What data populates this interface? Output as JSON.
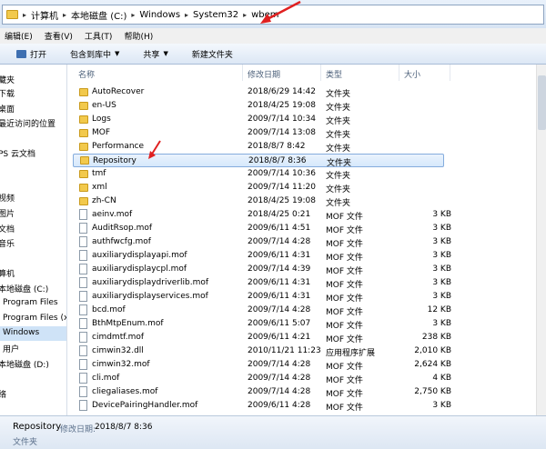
{
  "address_bar": {
    "crumbs": [
      "计算机",
      "本地磁盘 (C:)",
      "Windows",
      "System32",
      "wbem"
    ]
  },
  "menu": {
    "items": [
      "编辑(E)",
      "查看(V)",
      "工具(T)",
      "帮助(H)"
    ]
  },
  "toolbar": {
    "open_label": "打开",
    "include_label": "包含到库中",
    "share_label": "共享",
    "new_folder_label": "新建文件夹"
  },
  "nav": {
    "items": [
      "藏夹",
      "下载",
      "桌面",
      "最近访问的位置",
      "PS 云文档",
      "视频",
      "图片",
      "文档",
      "音乐",
      "算机",
      "本地磁盘 (C:)",
      "Program Files",
      "Program Files (x",
      "Windows",
      "用户",
      "本地磁盘 (D:)",
      "络"
    ]
  },
  "columns": {
    "name": "名称",
    "modified": "修改日期",
    "type": "类型",
    "size": "大小"
  },
  "files": [
    {
      "name": "AutoRecover",
      "date": "2018/6/29 14:42",
      "type": "文件夹",
      "size": "",
      "kind": "folder"
    },
    {
      "name": "en-US",
      "date": "2018/4/25 19:08",
      "type": "文件夹",
      "size": "",
      "kind": "folder"
    },
    {
      "name": "Logs",
      "date": "2009/7/14 10:34",
      "type": "文件夹",
      "size": "",
      "kind": "folder"
    },
    {
      "name": "MOF",
      "date": "2009/7/14 13:08",
      "type": "文件夹",
      "size": "",
      "kind": "folder"
    },
    {
      "name": "Performance",
      "date": "2018/8/7 8:42",
      "type": "文件夹",
      "size": "",
      "kind": "folder"
    },
    {
      "name": "Repository",
      "date": "2018/8/7 8:36",
      "type": "文件夹",
      "size": "",
      "kind": "folder",
      "selected": true
    },
    {
      "name": "tmf",
      "date": "2009/7/14 10:36",
      "type": "文件夹",
      "size": "",
      "kind": "folder"
    },
    {
      "name": "xml",
      "date": "2009/7/14 11:20",
      "type": "文件夹",
      "size": "",
      "kind": "folder"
    },
    {
      "name": "zh-CN",
      "date": "2018/4/25 19:08",
      "type": "文件夹",
      "size": "",
      "kind": "folder"
    },
    {
      "name": "aeinv.mof",
      "date": "2018/4/25 0:21",
      "type": "MOF 文件",
      "size": "3 KB",
      "kind": "file"
    },
    {
      "name": "AuditRsop.mof",
      "date": "2009/6/11 4:51",
      "type": "MOF 文件",
      "size": "3 KB",
      "kind": "file"
    },
    {
      "name": "authfwcfg.mof",
      "date": "2009/7/14 4:28",
      "type": "MOF 文件",
      "size": "3 KB",
      "kind": "file"
    },
    {
      "name": "auxiliarydisplayapi.mof",
      "date": "2009/6/11 4:31",
      "type": "MOF 文件",
      "size": "3 KB",
      "kind": "file"
    },
    {
      "name": "auxiliarydisplaycpl.mof",
      "date": "2009/7/14 4:39",
      "type": "MOF 文件",
      "size": "3 KB",
      "kind": "file"
    },
    {
      "name": "auxiliarydisplaydriverlib.mof",
      "date": "2009/6/11 4:31",
      "type": "MOF 文件",
      "size": "3 KB",
      "kind": "file"
    },
    {
      "name": "auxiliarydisplayservices.mof",
      "date": "2009/6/11 4:31",
      "type": "MOF 文件",
      "size": "3 KB",
      "kind": "file"
    },
    {
      "name": "bcd.mof",
      "date": "2009/7/14 4:28",
      "type": "MOF 文件",
      "size": "12 KB",
      "kind": "file"
    },
    {
      "name": "BthMtpEnum.mof",
      "date": "2009/6/11 5:07",
      "type": "MOF 文件",
      "size": "3 KB",
      "kind": "file"
    },
    {
      "name": "cimdmtf.mof",
      "date": "2009/6/11 4:21",
      "type": "MOF 文件",
      "size": "238 KB",
      "kind": "file"
    },
    {
      "name": "cimwin32.dll",
      "date": "2010/11/21 11:23",
      "type": "应用程序扩展",
      "size": "2,010 KB",
      "kind": "file"
    },
    {
      "name": "cimwin32.mof",
      "date": "2009/7/14 4:28",
      "type": "MOF 文件",
      "size": "2,624 KB",
      "kind": "file"
    },
    {
      "name": "cli.mof",
      "date": "2009/7/14 4:28",
      "type": "MOF 文件",
      "size": "4 KB",
      "kind": "file"
    },
    {
      "name": "cliegaliases.mof",
      "date": "2009/7/14 4:28",
      "type": "MOF 文件",
      "size": "2,750 KB",
      "kind": "file"
    },
    {
      "name": "DevicePairingHandler.mof",
      "date": "2009/6/11 4:28",
      "type": "MOF 文件",
      "size": "3 KB",
      "kind": "file"
    }
  ],
  "status": {
    "name": "Repository",
    "modified_label": "修改日期:",
    "modified_value": "2018/8/7 8:36",
    "type": "文件夹"
  },
  "colors": {
    "annotation_arrow": "#e02020",
    "selection": "#84acdd"
  }
}
